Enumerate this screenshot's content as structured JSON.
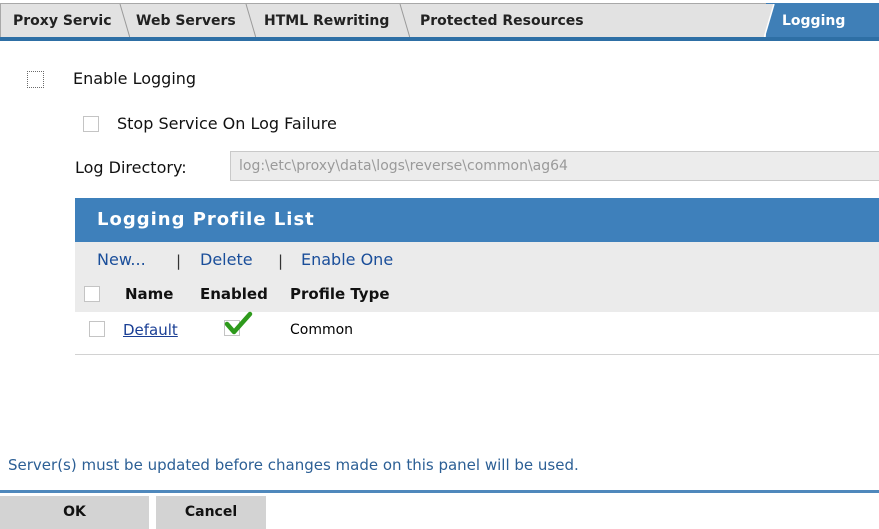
{
  "tabs": [
    {
      "label": "Proxy Service"
    },
    {
      "label": "Web Servers"
    },
    {
      "label": "HTML Rewriting"
    },
    {
      "label": "Protected Resources"
    },
    {
      "label": "Logging",
      "active": true
    }
  ],
  "form": {
    "enable_logging": {
      "label": "Enable Logging",
      "checked": false
    },
    "stop_service": {
      "label": "Stop Service On Log Failure",
      "checked": false
    },
    "log_directory": {
      "label": "Log Directory:",
      "value": "log:\\etc\\proxy\\data\\logs\\reverse\\common\\ag64"
    }
  },
  "profile_list": {
    "title": "Logging Profile List",
    "actions": {
      "new": "New...",
      "delete": "Delete",
      "enable_one": "Enable One"
    },
    "separator": "|",
    "columns": {
      "name": "Name",
      "enabled": "Enabled",
      "profile_type": "Profile Type"
    },
    "rows": [
      {
        "name": "Default",
        "enabled": true,
        "profile_type": "Common"
      }
    ]
  },
  "notice": "Server(s) must be updated before changes made on this panel will be used.",
  "buttons": {
    "ok": "OK",
    "cancel": "Cancel"
  },
  "colors": {
    "accent": "#3e80bb",
    "tab_active": "#3f7fb7",
    "notice_text": "#2c5f95",
    "check_green": "#2e9a1c"
  }
}
